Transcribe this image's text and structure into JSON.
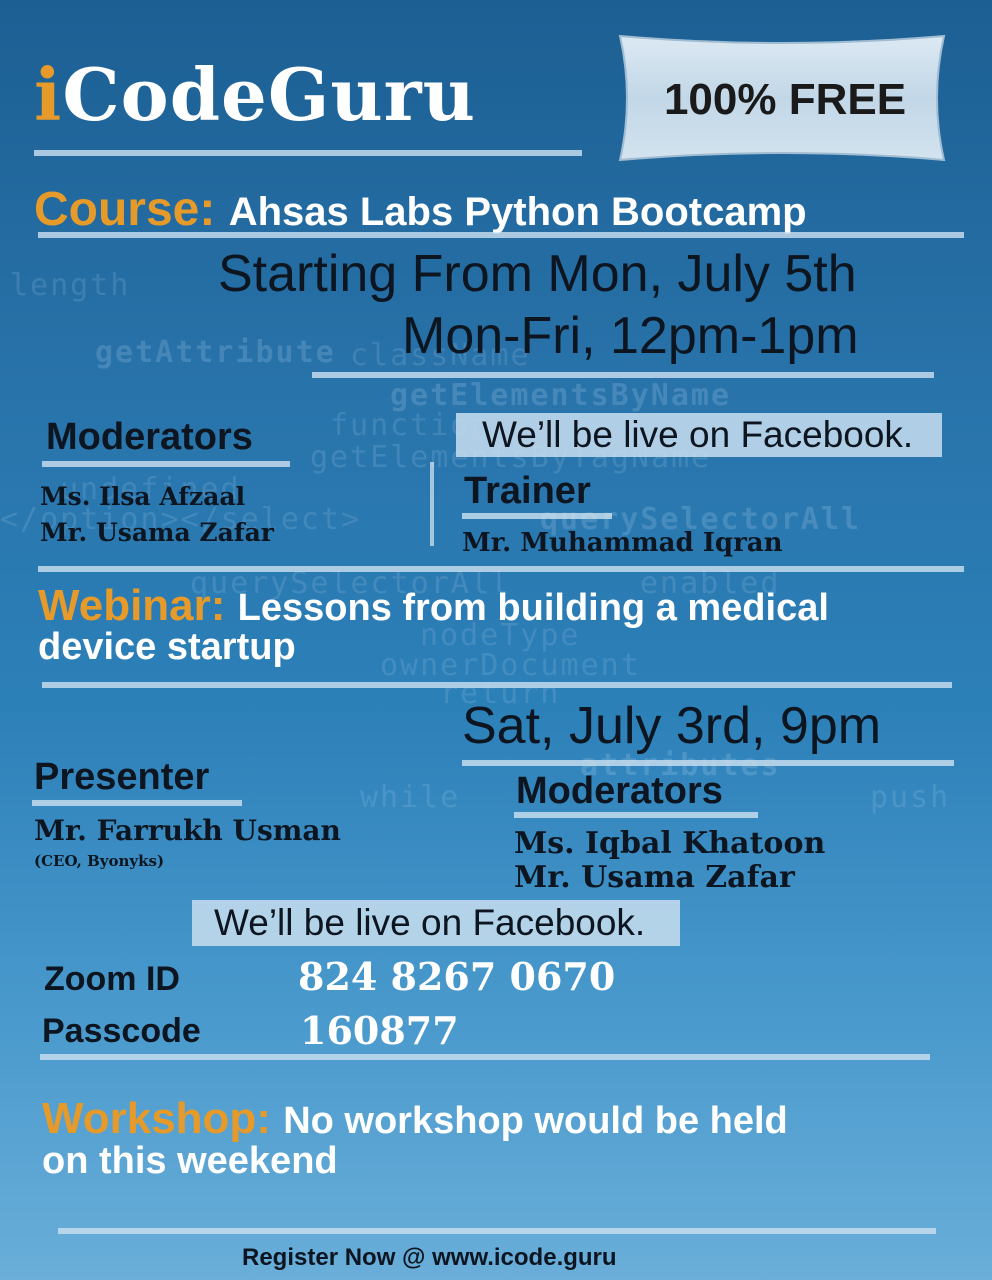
{
  "header": {
    "logo_i": "i",
    "logo_rest": "CodeGuru",
    "free_badge": "100% FREE"
  },
  "course": {
    "label": "Course:",
    "title": "Ahsas Labs Python Bootcamp",
    "start": "Starting From Mon, July 5th",
    "schedule": "Mon-Fri, 12pm-1pm",
    "moderators_heading": "Moderators",
    "moderators": [
      "Ms. Ilsa Afzaal",
      "Mr. Usama Zafar"
    ],
    "live_note": "We’ll be live on Facebook.",
    "trainer_heading": "Trainer",
    "trainer": "Mr. Muhammad Iqran"
  },
  "webinar": {
    "label": "Webinar:",
    "title_line1": "Lessons from building a medical",
    "title_line2": "device startup",
    "datetime": "Sat, July 3rd, 9pm",
    "presenter_heading": "Presenter",
    "presenter_name": "Mr. Farrukh Usman",
    "presenter_role": "(CEO, Byonyks)",
    "moderators_heading": "Moderators",
    "moderators": [
      "Ms. Iqbal Khatoon",
      "Mr. Usama Zafar"
    ],
    "live_note": "We’ll be live on Facebook.",
    "zoom_label": "Zoom ID",
    "zoom_id": "824 8267 0670",
    "passcode_label": "Passcode",
    "passcode": "160877"
  },
  "workshop": {
    "label": "Workshop:",
    "text_line1": "No workshop would be held",
    "text_line2": "on this weekend"
  },
  "footer": {
    "register": "Register Now @ www.icode.guru"
  },
  "background_code": [
    "length",
    "getAttribute",
    "className",
    "getElementsByName",
    "function",
    "getElementsByTagName",
    "undefined",
    "querySelectorAll",
    "</option></select>",
    "nodeType",
    "ownerDocument",
    "return",
    "attributes",
    "while",
    "push",
    "enabled"
  ],
  "colors": {
    "accent_orange": "#e69a2a",
    "background_blue": "#2873aa",
    "text_dark": "#0d1620",
    "badge_silver": "#c9dcea"
  }
}
